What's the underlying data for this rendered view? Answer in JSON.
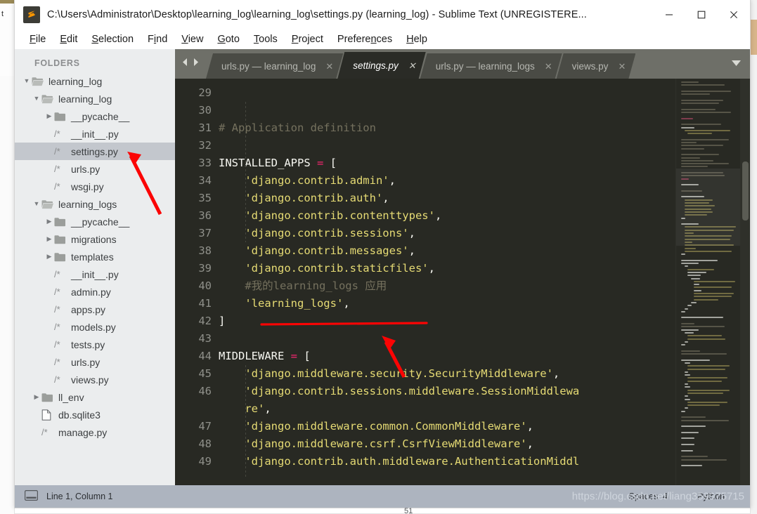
{
  "window": {
    "title": "C:\\Users\\Administrator\\Desktop\\learning_log\\learning_log\\settings.py (learning_log) - Sublime Text (UNREGISTERE...",
    "app_icon": "sublime-text-icon",
    "minimize": "—",
    "maximize": "☐",
    "close": "✕",
    "background_window_text": "t"
  },
  "menubar": {
    "items": [
      {
        "label": "File",
        "accel": "F"
      },
      {
        "label": "Edit",
        "accel": "E"
      },
      {
        "label": "Selection",
        "accel": "S"
      },
      {
        "label": "Find",
        "accel": "i"
      },
      {
        "label": "View",
        "accel": "V"
      },
      {
        "label": "Goto",
        "accel": "G"
      },
      {
        "label": "Tools",
        "accel": "T"
      },
      {
        "label": "Project",
        "accel": "P"
      },
      {
        "label": "Preferences",
        "accel": "n"
      },
      {
        "label": "Help",
        "accel": "H"
      }
    ]
  },
  "sidebar": {
    "header": "FOLDERS",
    "items": [
      {
        "label": "learning_log",
        "depth": 0,
        "type": "folder-open",
        "arrow": "down",
        "selected": false
      },
      {
        "label": "learning_log",
        "depth": 1,
        "type": "folder-open",
        "arrow": "down",
        "selected": false
      },
      {
        "label": "__pycache__",
        "depth": 2,
        "type": "folder-closed",
        "arrow": "right",
        "selected": false
      },
      {
        "label": "__init__.py",
        "depth": 2,
        "type": "python-file",
        "arrow": "none",
        "selected": false
      },
      {
        "label": "settings.py",
        "depth": 2,
        "type": "python-file",
        "arrow": "none",
        "selected": true
      },
      {
        "label": "urls.py",
        "depth": 2,
        "type": "python-file",
        "arrow": "none",
        "selected": false
      },
      {
        "label": "wsgi.py",
        "depth": 2,
        "type": "python-file",
        "arrow": "none",
        "selected": false
      },
      {
        "label": "learning_logs",
        "depth": 1,
        "type": "folder-open",
        "arrow": "down",
        "selected": false
      },
      {
        "label": "__pycache__",
        "depth": 2,
        "type": "folder-closed",
        "arrow": "right",
        "selected": false
      },
      {
        "label": "migrations",
        "depth": 2,
        "type": "folder-closed",
        "arrow": "right",
        "selected": false
      },
      {
        "label": "templates",
        "depth": 2,
        "type": "folder-closed",
        "arrow": "right",
        "selected": false
      },
      {
        "label": "__init__.py",
        "depth": 2,
        "type": "python-file",
        "arrow": "none",
        "selected": false
      },
      {
        "label": "admin.py",
        "depth": 2,
        "type": "python-file",
        "arrow": "none",
        "selected": false
      },
      {
        "label": "apps.py",
        "depth": 2,
        "type": "python-file",
        "arrow": "none",
        "selected": false
      },
      {
        "label": "models.py",
        "depth": 2,
        "type": "python-file",
        "arrow": "none",
        "selected": false
      },
      {
        "label": "tests.py",
        "depth": 2,
        "type": "python-file",
        "arrow": "none",
        "selected": false
      },
      {
        "label": "urls.py",
        "depth": 2,
        "type": "python-file",
        "arrow": "none",
        "selected": false
      },
      {
        "label": "views.py",
        "depth": 2,
        "type": "python-file",
        "arrow": "none",
        "selected": false
      },
      {
        "label": "ll_env",
        "depth": 1,
        "type": "folder-closed",
        "arrow": "right",
        "selected": false
      },
      {
        "label": "db.sqlite3",
        "depth": 1,
        "type": "generic-file",
        "arrow": "none",
        "selected": false
      },
      {
        "label": "manage.py",
        "depth": 1,
        "type": "python-file",
        "arrow": "none",
        "selected": false
      }
    ]
  },
  "tabbar": {
    "nav_prev_icon": "chevron-left-icon",
    "nav_next_icon": "chevron-right-icon",
    "menu_icon": "chevron-down-icon",
    "close_glyph": "✕",
    "tabs": [
      {
        "label": "urls.py — learning_log",
        "active": false
      },
      {
        "label": "settings.py",
        "active": true
      },
      {
        "label": "urls.py — learning_logs",
        "active": false
      },
      {
        "label": "views.py",
        "active": false
      }
    ]
  },
  "editor": {
    "first_line": 29,
    "lines": [
      {
        "num": "29",
        "tokens": []
      },
      {
        "num": "30",
        "tokens": []
      },
      {
        "num": "31",
        "tokens": [
          {
            "t": "comment",
            "s": "# Application definition"
          }
        ]
      },
      {
        "num": "32",
        "tokens": []
      },
      {
        "num": "33",
        "tokens": [
          {
            "t": "var",
            "s": "INSTALLED_APPS "
          },
          {
            "t": "op",
            "s": "="
          },
          {
            "t": "punc",
            "s": " ["
          }
        ]
      },
      {
        "num": "34",
        "tokens": [
          {
            "t": "str",
            "s": "    'django.contrib.admin'"
          },
          {
            "t": "punc",
            "s": ","
          }
        ]
      },
      {
        "num": "35",
        "tokens": [
          {
            "t": "str",
            "s": "    'django.contrib.auth'"
          },
          {
            "t": "punc",
            "s": ","
          }
        ]
      },
      {
        "num": "36",
        "tokens": [
          {
            "t": "str",
            "s": "    'django.contrib.contenttypes'"
          },
          {
            "t": "punc",
            "s": ","
          }
        ]
      },
      {
        "num": "37",
        "tokens": [
          {
            "t": "str",
            "s": "    'django.contrib.sessions'"
          },
          {
            "t": "punc",
            "s": ","
          }
        ]
      },
      {
        "num": "38",
        "tokens": [
          {
            "t": "str",
            "s": "    'django.contrib.messages'"
          },
          {
            "t": "punc",
            "s": ","
          }
        ]
      },
      {
        "num": "39",
        "tokens": [
          {
            "t": "str",
            "s": "    'django.contrib.staticfiles'"
          },
          {
            "t": "punc",
            "s": ","
          }
        ]
      },
      {
        "num": "40",
        "tokens": [
          {
            "t": "comment",
            "s": "    #我的learning_logs 应用"
          }
        ]
      },
      {
        "num": "41",
        "tokens": [
          {
            "t": "str",
            "s": "    'learning_logs'"
          },
          {
            "t": "punc",
            "s": ","
          }
        ]
      },
      {
        "num": "42",
        "tokens": [
          {
            "t": "punc",
            "s": "]"
          }
        ]
      },
      {
        "num": "43",
        "tokens": []
      },
      {
        "num": "44",
        "tokens": [
          {
            "t": "var",
            "s": "MIDDLEWARE "
          },
          {
            "t": "op",
            "s": "="
          },
          {
            "t": "punc",
            "s": " ["
          }
        ]
      },
      {
        "num": "45",
        "tokens": [
          {
            "t": "str",
            "s": "    'django.middleware.security.SecurityMiddleware'"
          },
          {
            "t": "punc",
            "s": ","
          }
        ]
      },
      {
        "num": "46",
        "tokens": [
          {
            "t": "str",
            "s": "    'django.contrib.sessions.middleware.SessionMiddlewa"
          }
        ]
      },
      {
        "num": "",
        "tokens": [
          {
            "t": "str",
            "s": "    re'"
          },
          {
            "t": "punc",
            "s": ","
          }
        ]
      },
      {
        "num": "47",
        "tokens": [
          {
            "t": "str",
            "s": "    'django.middleware.common.CommonMiddleware'"
          },
          {
            "t": "punc",
            "s": ","
          }
        ]
      },
      {
        "num": "48",
        "tokens": [
          {
            "t": "str",
            "s": "    'django.middleware.csrf.CsrfViewMiddleware'"
          },
          {
            "t": "punc",
            "s": ","
          }
        ]
      },
      {
        "num": "49",
        "tokens": [
          {
            "t": "str",
            "s": "    'django.contrib.auth.middleware.AuthenticationMiddl"
          }
        ]
      }
    ]
  },
  "annotations": [
    {
      "name": "arrow-to-settings-py",
      "kind": "arrow"
    },
    {
      "name": "underline-learning-logs",
      "kind": "underline"
    },
    {
      "name": "arrow-to-learning-logs",
      "kind": "arrow"
    }
  ],
  "statusbar": {
    "layout_icon": "pane-layout-icon",
    "position": "Line 1, Column 1",
    "indent": "Spaces: 4",
    "syntax": "Python",
    "watermark": "https://blog.csdn.net/liang359975715"
  },
  "page_bottom": {
    "number": "51"
  },
  "colors": {
    "editor_bg": "#282923",
    "sidebar_bg": "#ebedee",
    "sidebar_selected": "#c3c7cd",
    "tabbar_bg": "#6e6f68",
    "tab_inactive": "#4a4b45",
    "tab_active": "#2a2b26",
    "statusbar_bg": "#adb4bf",
    "string": "#e6db74",
    "comment": "#75715e",
    "operator": "#f92672",
    "text": "#f8f8f2",
    "annotation_red": "#fb0404"
  }
}
